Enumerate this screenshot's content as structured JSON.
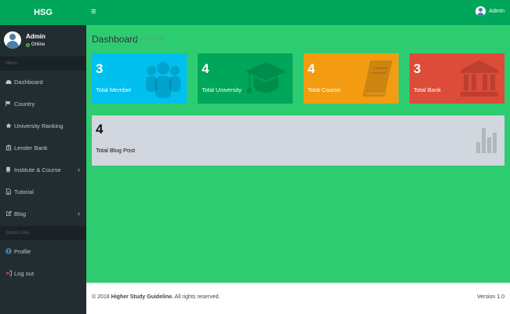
{
  "app": {
    "logo": "HSG"
  },
  "user": {
    "name": "Admin",
    "status": "Online"
  },
  "sidebar": {
    "menu_header": "Menu",
    "items": [
      {
        "label": "Dashboard",
        "icon": "dashboard-icon"
      },
      {
        "label": "Country",
        "icon": "flag-icon"
      },
      {
        "label": "University Ranking",
        "icon": "star-icon"
      },
      {
        "label": "Lender Bank",
        "icon": "bank-icon"
      },
      {
        "label": "Institute & Course",
        "icon": "book-icon",
        "has_submenu": true
      },
      {
        "label": "Tutorial",
        "icon": "file-icon"
      },
      {
        "label": "Blog",
        "icon": "edit-icon",
        "has_submenu": true
      }
    ],
    "quick_links_header": "Quick Links",
    "quick_links": [
      {
        "label": "Profile",
        "icon": "user-circle-icon",
        "color": "#3c8dbc"
      },
      {
        "label": "Log out",
        "icon": "sign-out-icon",
        "color": "#dd4b39"
      }
    ]
  },
  "header": {
    "menu_toggle": "≡",
    "user_label": "Admin"
  },
  "content": {
    "title": "Dashboard",
    "subtitle": "Control panel",
    "stats": [
      {
        "number": "3",
        "label": "Total Member",
        "icon": "users-icon",
        "color": "#00c0ef"
      },
      {
        "number": "4",
        "label": "Total University",
        "icon": "graduation-cap-icon",
        "color": "#00a65a"
      },
      {
        "number": "4",
        "label": "Total Course",
        "icon": "book-icon",
        "color": "#f39c12"
      },
      {
        "number": "3",
        "label": "Total Bank",
        "icon": "bank-icon",
        "color": "#dd4b39"
      }
    ],
    "blog": {
      "number": "4",
      "label": "Total Blog Post",
      "icon": "bar-chart-icon",
      "color": "#d2d6de"
    }
  },
  "footer": {
    "copyright_prefix": "© 2018",
    "copyright_name": "Higher Study Guideline.",
    "copyright_suffix": "All rights reserved.",
    "version": "Version 1.0"
  },
  "colors": {
    "sidebar": "#222d32",
    "header": "#00a65a",
    "content_bg": "#2ecc71"
  }
}
